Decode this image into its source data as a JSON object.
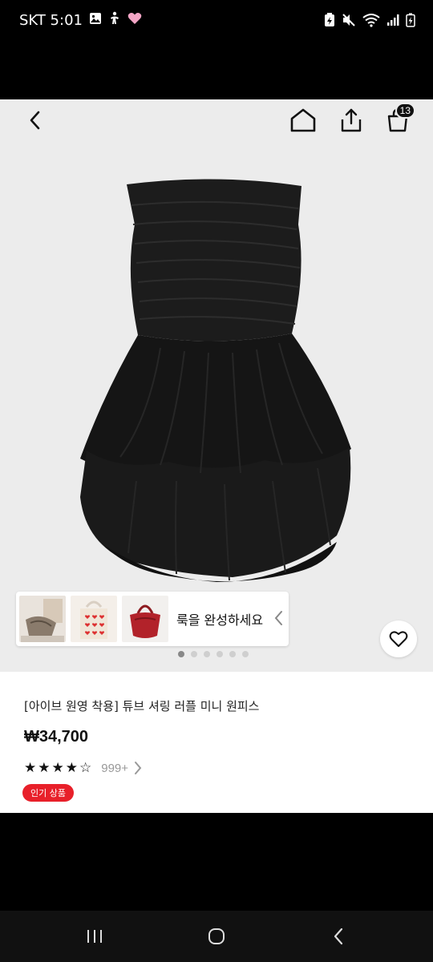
{
  "status_bar": {
    "time_text": "SKT 5:01",
    "left_icons": [
      "gallery-icon",
      "accessibility-icon",
      "heart-icon"
    ],
    "right_icons": [
      "battery-saver-icon",
      "mute-icon",
      "wifi-icon",
      "signal-icon",
      "battery-icon"
    ]
  },
  "header": {
    "icons": [
      "back-icon",
      "home-icon",
      "share-icon",
      "cart-icon"
    ],
    "cart_count": "13"
  },
  "gallery": {
    "total_images": 6,
    "active_index": 0
  },
  "look_card": {
    "label": "룩을 완성하세요",
    "thumbnails": [
      "bag-thumbnail",
      "heart-tote-thumbnail",
      "red-bag-thumbnail"
    ]
  },
  "product": {
    "title": "[아이브 원영 착용] 튜브 셔링 러플 미니 원피스",
    "price": "₩34,700",
    "rating_stars": 4,
    "review_count": "999+",
    "badge": "인기 상품"
  },
  "colors": {
    "accent_red": "#e8202a",
    "hero_bg": "#ececec"
  }
}
